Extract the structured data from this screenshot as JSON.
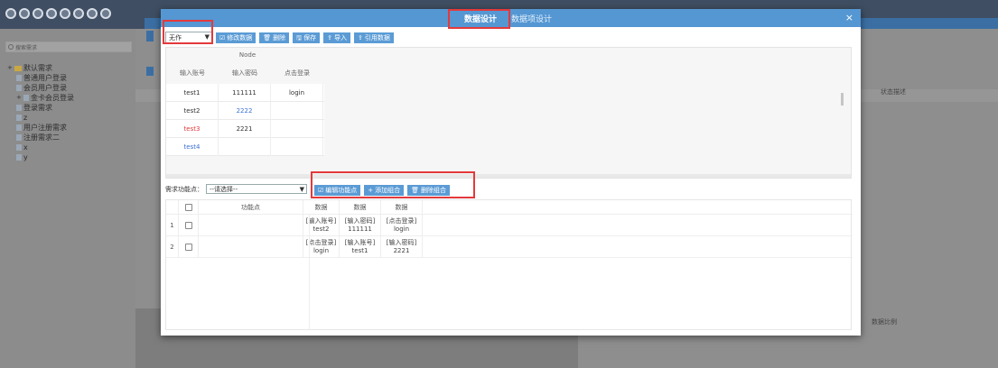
{
  "background": {
    "search_placeholder": "搜索需求",
    "tree": [
      {
        "label": "默认需求",
        "level": 0,
        "type": "folder",
        "expander": "+"
      },
      {
        "label": "普通用户登录",
        "level": 1,
        "type": "file"
      },
      {
        "label": "会员用户登录",
        "level": 1,
        "type": "file"
      },
      {
        "label": "金卡会员登录",
        "level": 1,
        "type": "file",
        "expander": "+"
      },
      {
        "label": "登录需求",
        "level": 1,
        "type": "file"
      },
      {
        "label": "z",
        "level": 1,
        "type": "file"
      },
      {
        "label": "用户注册需求",
        "level": 1,
        "type": "file"
      },
      {
        "label": "注册需求二",
        "level": 1,
        "type": "file"
      },
      {
        "label": "x",
        "level": 1,
        "type": "file"
      },
      {
        "label": "y",
        "level": 1,
        "type": "file"
      }
    ],
    "right_label_1": "状态描述",
    "right_label_2": "数据比例"
  },
  "modal": {
    "tab_active": "数据设计",
    "tab_second": "数据项设计",
    "close": "×"
  },
  "toolbar": {
    "select_value": "无作",
    "buttons": [
      {
        "icon": "☑",
        "label": "修改数据"
      },
      {
        "icon": "🗑",
        "label": "删除"
      },
      {
        "icon": "🖫",
        "label": "保存"
      },
      {
        "icon": "⇪",
        "label": "导入"
      },
      {
        "icon": "⇪",
        "label": "引用数据"
      }
    ]
  },
  "upper_table": {
    "group_header": "Node",
    "headers": [
      "输入账号",
      "输入密码",
      "点击登录"
    ],
    "rows": [
      {
        "cells": [
          "test1",
          "111111",
          "login"
        ],
        "style": [
          "",
          "",
          ""
        ]
      },
      {
        "cells": [
          "test2",
          "2222",
          ""
        ],
        "style": [
          "",
          "blue",
          ""
        ]
      },
      {
        "cells": [
          "test3",
          "2221",
          ""
        ],
        "style": [
          "red",
          "",
          ""
        ]
      },
      {
        "cells": [
          "test4",
          "",
          ""
        ],
        "style": [
          "blue",
          "",
          ""
        ]
      }
    ]
  },
  "lower_bar": {
    "label": "需求功能点：",
    "select_value": "--请选择--",
    "buttons": [
      {
        "icon": "☑",
        "label": "编辑功能点"
      },
      {
        "icon": "+",
        "label": "添加组合"
      },
      {
        "icon": "🗑",
        "label": "删除组合"
      }
    ]
  },
  "lower_table": {
    "headers": [
      "",
      "",
      "功能点",
      "数据",
      "数据",
      "数据"
    ],
    "rows": [
      {
        "index": "1",
        "c3": [
          "[输入账号]",
          "test2"
        ],
        "c4": [
          "[输入密码]",
          "111111"
        ],
        "c5": [
          "[点击登录]",
          "login"
        ]
      },
      {
        "index": "2",
        "c3": [
          "[点击登录]",
          "login"
        ],
        "c4": [
          "[输入账号]",
          "test1"
        ],
        "c5": [
          "[输入密码]",
          "2221"
        ]
      }
    ]
  },
  "colors": {
    "header_blue": "#5497d3",
    "button_blue": "#5b9bd5",
    "highlight_red": "#e4393c",
    "text_blue": "#3a6fd8"
  }
}
